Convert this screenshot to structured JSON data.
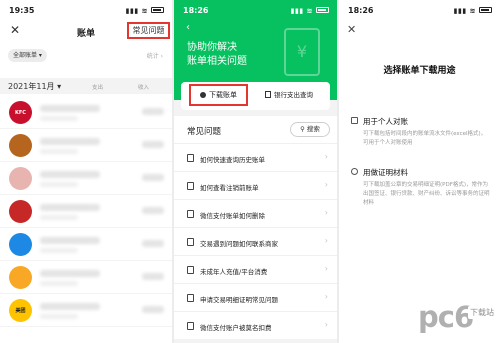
{
  "panel1": {
    "status_time": "19:35",
    "nav_title": "账单",
    "faq_button": "常见问题",
    "filter_chip": "全部账单 ▾",
    "stats_link": "统计 ›",
    "month": "2021年11月 ▾",
    "month_meta_out": "支出",
    "month_meta_in": "收入",
    "rows": [
      {
        "logo": "KFC",
        "logo_color": "#c8102e"
      },
      {
        "logo": "",
        "logo_color": "#b5651d"
      },
      {
        "logo": "",
        "logo_color": "#e8b4b0"
      },
      {
        "logo": "",
        "logo_color": "#c62828"
      },
      {
        "logo": "",
        "logo_color": "#1e88e5"
      },
      {
        "logo": "",
        "logo_color": "#f9a825"
      },
      {
        "logo": "美团",
        "logo_color": "#ffc300"
      }
    ]
  },
  "panel2": {
    "status_time": "18:26",
    "hero_title": "协助你解决\n账单相关问题",
    "hero_icon": "¥",
    "download_button": "下载账单",
    "bank_button": "银行支出查询",
    "faq_title": "常见问题",
    "search_button": "搜索",
    "faq_items": [
      "如何快速查询历史账单",
      "如何查看注销前账单",
      "微信支付账单如何删除",
      "交易遇到问题如何联系商家",
      "未成年人充值/平台消费",
      "申请交易明细证明常见问题",
      "微信支付账户被莫名扣费"
    ]
  },
  "panel3": {
    "status_time": "18:26",
    "title": "选择账单下载用途",
    "options": [
      {
        "title": "用于个人对账",
        "desc": "可下载包括时间段内的账单流水文件(excel格式)，可用于个人对账使用"
      },
      {
        "title": "用做证明材料",
        "desc": "可下载加盖公章的交易明细证明(PDF格式)，常作为出国签证、银行贷款、财产纠纷、诉讼等事务的证明材料"
      }
    ]
  },
  "watermark": {
    "big": "pc6",
    "small": "下载站"
  },
  "colors": {
    "wechat_green": "#07c160",
    "highlight_red": "#e2362f"
  }
}
